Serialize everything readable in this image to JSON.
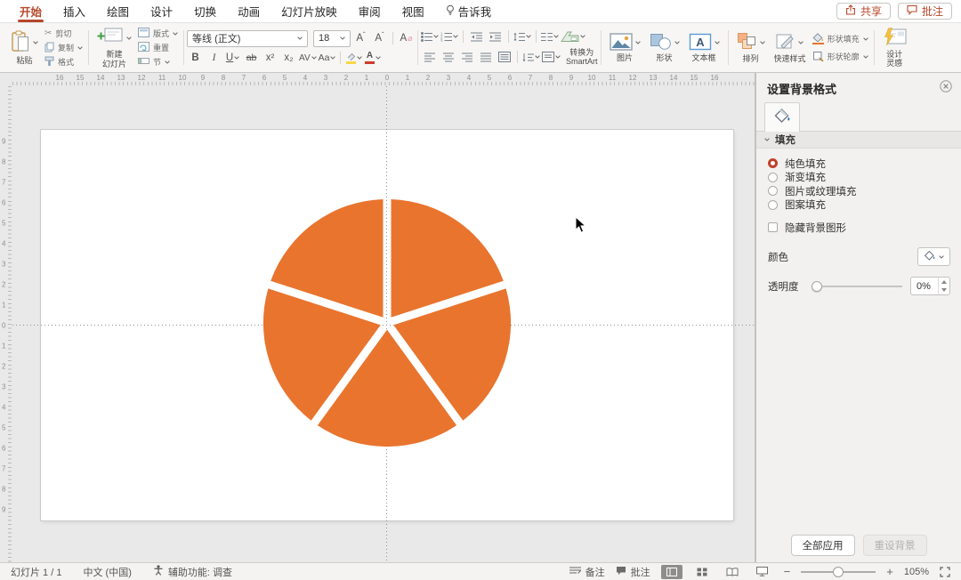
{
  "menubar": {
    "items": [
      {
        "label": "开始",
        "active": true
      },
      {
        "label": "插入",
        "active": false
      },
      {
        "label": "绘图",
        "active": false
      },
      {
        "label": "设计",
        "active": false
      },
      {
        "label": "切换",
        "active": false
      },
      {
        "label": "动画",
        "active": false
      },
      {
        "label": "幻灯片放映",
        "active": false
      },
      {
        "label": "审阅",
        "active": false
      },
      {
        "label": "视图",
        "active": false
      },
      {
        "label": "告诉我",
        "active": false
      }
    ],
    "share": "共享",
    "comments": "批注"
  },
  "ribbon": {
    "paste": "粘贴",
    "cut": "剪切",
    "copy": "复制",
    "format_painter": "格式",
    "new_slide_line1": "新建",
    "new_slide_line2": "幻灯片",
    "layout": "版式",
    "reset": "重置",
    "section": "节",
    "font_name": "等线 (正文)",
    "font_size": "18",
    "glyph_bold": "B",
    "glyph_italic": "I",
    "glyph_underline": "U",
    "glyph_strike": "ab",
    "glyph_sup": "x²",
    "glyph_sub": "x₂",
    "glyph_spacing": "AV",
    "glyph_case": "Aa",
    "glyph_grow": "A",
    "glyph_shrink": "A",
    "glyph_clear": "A",
    "glyph_fontcolor": "A",
    "smartart_line1": "转换为",
    "smartart_line2": "SmartArt",
    "picture": "图片",
    "shapes": "形状",
    "textbox": "文本框",
    "arrange": "排列",
    "quick_styles": "快速样式",
    "shape_fill": "形状填充",
    "shape_outline": "形状轮廓",
    "design_line1": "设计",
    "design_line2": "灵感"
  },
  "canvas": {
    "ruler_h_numbers": [
      "16",
      "15",
      "14",
      "13",
      "12",
      "11",
      "10",
      "9",
      "8",
      "7",
      "6",
      "5",
      "4",
      "3",
      "2",
      "1",
      "0",
      "1",
      "2",
      "3",
      "4",
      "5",
      "6",
      "7",
      "8",
      "9",
      "10",
      "11",
      "12",
      "13",
      "14",
      "15",
      "16"
    ],
    "ruler_v_numbers": [
      "9",
      "8",
      "7",
      "6",
      "5",
      "4",
      "3",
      "2",
      "1",
      "0",
      "1",
      "2",
      "3",
      "4",
      "5",
      "6",
      "7",
      "8",
      "9"
    ]
  },
  "chart_data": {
    "type": "pie",
    "values": [
      20,
      20,
      20,
      20,
      20
    ],
    "categories": [
      "",
      "",
      "",
      "",
      ""
    ],
    "title": "",
    "color": "#E8742D",
    "gap_color": "#FFFFFF",
    "start_angle_deg": 0,
    "legend": "none"
  },
  "panel": {
    "title": "设置背景格式",
    "section_fill": "填充",
    "fill_options": [
      {
        "label": "纯色填充",
        "selected": true
      },
      {
        "label": "渐变填充",
        "selected": false
      },
      {
        "label": "图片或纹理填充",
        "selected": false
      },
      {
        "label": "图案填充",
        "selected": false
      }
    ],
    "hide_background": "隐藏背景图形",
    "color_label": "颜色",
    "transparency_label": "透明度",
    "transparency_value": "0%",
    "apply_all": "全部应用",
    "reset_background": "重设背景"
  },
  "statusbar": {
    "slide_counter": "幻灯片 1 / 1",
    "language": "中文 (中国)",
    "accessibility": "辅助功能: 调查",
    "notes": "备注",
    "comments": "批注",
    "zoom_level": "105%"
  }
}
